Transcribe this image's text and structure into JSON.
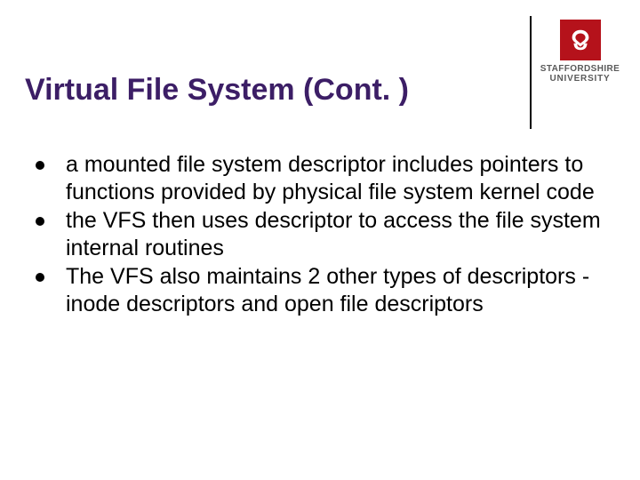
{
  "logo": {
    "line1": "STAFFORDSHIRE",
    "line2": "UNIVERSITY"
  },
  "title": "Virtual File System (Cont. )",
  "bullets": [
    "a mounted file system descriptor includes pointers to functions provided by physical file system kernel code",
    "the VFS then uses descriptor to access the file system internal routines",
    "The VFS also maintains 2 other types of descriptors - inode descriptors and open file descriptors"
  ]
}
